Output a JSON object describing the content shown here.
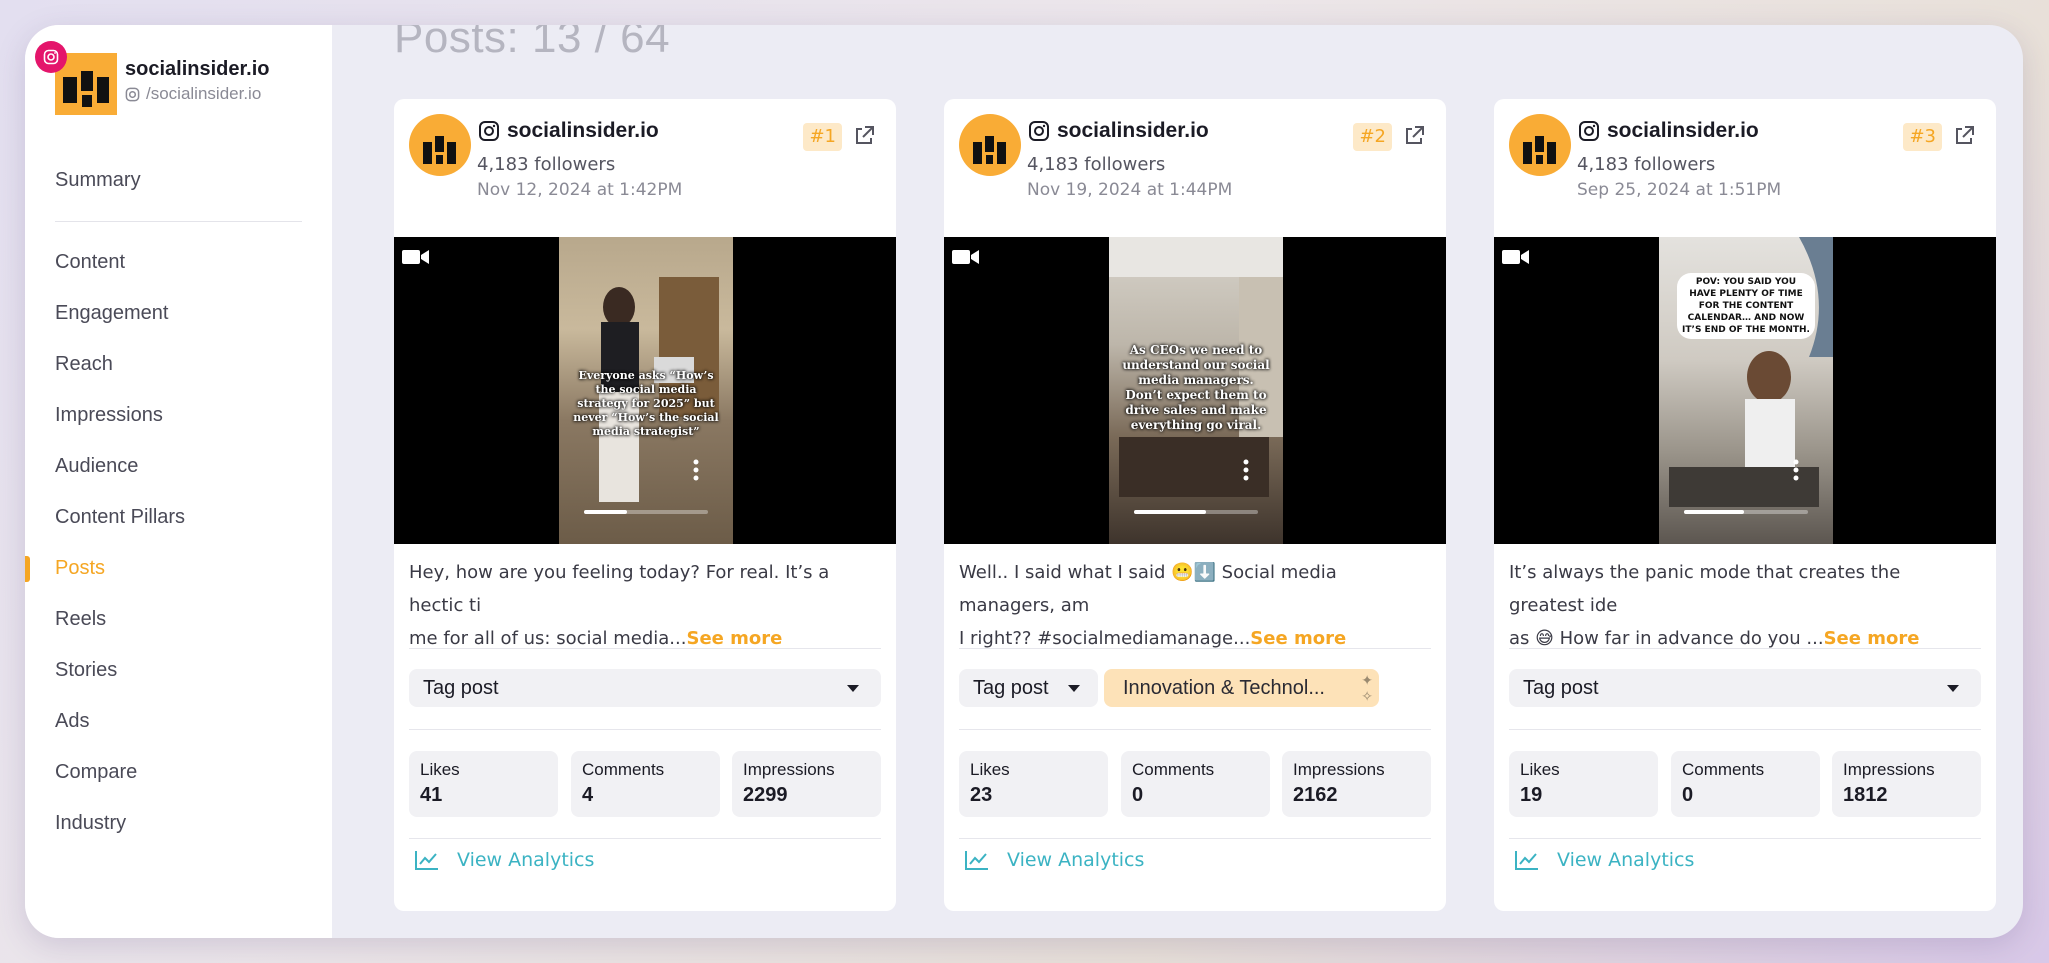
{
  "sidebar": {
    "profile": {
      "name": "socialinsider.io",
      "handle": "/socialinsider.io"
    },
    "items": [
      {
        "label": "Summary"
      },
      {
        "label": "Content"
      },
      {
        "label": "Engagement"
      },
      {
        "label": "Reach"
      },
      {
        "label": "Impressions"
      },
      {
        "label": "Audience"
      },
      {
        "label": "Content Pillars"
      },
      {
        "label": "Posts",
        "active": true
      },
      {
        "label": "Reels"
      },
      {
        "label": "Stories"
      },
      {
        "label": "Ads"
      },
      {
        "label": "Compare"
      },
      {
        "label": "Industry"
      }
    ]
  },
  "main": {
    "title": "Posts: 13 / 64",
    "see_more_label": "See more",
    "tag_select_label": "Tag post",
    "view_analytics_label": "View Analytics",
    "metric_labels": {
      "likes": "Likes",
      "comments": "Comments",
      "impressions": "Impressions"
    },
    "posts": [
      {
        "account": "socialinsider.io",
        "followers": "4,183 followers",
        "date": "Nov 12, 2024 at 1:42PM",
        "rank": "#1",
        "thumb_text": "Everyone asks “How’s the social media strategy for 2025” but never “How’s the social media strategist”",
        "caption_line1": "Hey, how are you feeling today? For real. It’s a hectic ti",
        "caption_line2": "me for all of us: social media...",
        "likes": "41",
        "comments": "4",
        "impressions": "2299",
        "progress": 0.35
      },
      {
        "account": "socialinsider.io",
        "followers": "4,183 followers",
        "date": "Nov 19, 2024 at 1:44PM",
        "rank": "#2",
        "thumb_text": "As CEOs we need to understand our social media managers. Don’t expect them to drive sales and make everything go viral.",
        "caption_line1": "Well.. I said what I said 😬⬇️ Social media managers, am",
        "caption_line2": "I right?? #socialmediamanage...",
        "tag_chip": "Innovation & Technol...",
        "likes": "23",
        "comments": "0",
        "impressions": "2162",
        "progress": 0.58
      },
      {
        "account": "socialinsider.io",
        "followers": "4,183 followers",
        "date": "Sep 25, 2024 at 1:51PM",
        "rank": "#3",
        "thumb_text": "POV: YOU SAID YOU HAVE PLENTY OF TIME FOR THE CONTENT CALENDAR… AND NOW IT’S END OF THE MONTH.",
        "caption_line1": "It’s always the panic mode that creates the greatest ide",
        "caption_line2": "as 😅 How far in advance do you ...",
        "likes": "19",
        "comments": "0",
        "impressions": "1812",
        "progress": 0.48
      }
    ]
  },
  "colors": {
    "accent": "#f5a623",
    "link": "#3bb3c3",
    "instagram": "#e4156b",
    "avatar": "#f9ac36"
  }
}
